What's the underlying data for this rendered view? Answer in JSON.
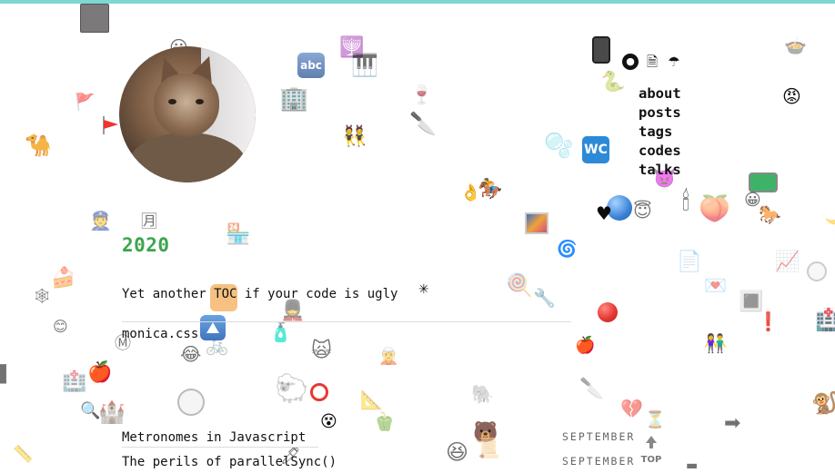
{
  "nav": {
    "icons": [
      {
        "name": "github-icon",
        "glyph": "◉"
      },
      {
        "name": "file-icon",
        "glyph": "🗎"
      },
      {
        "name": "umbrella-icon",
        "glyph": "☂"
      }
    ],
    "links": [
      "about",
      "posts",
      "tags",
      "codes",
      "talks"
    ]
  },
  "content": {
    "year": "2020",
    "post1": "Yet another TOC if your code is ugly",
    "post2": "monica.css",
    "post3": "Metronomes in Javascript",
    "post4": "The perils of parallelSync()",
    "month1": "SEPTEMBER",
    "month2": "SEPTEMBER"
  },
  "labels": {
    "abc": "abc",
    "wc": "WC",
    "top": "TOP"
  },
  "decorations": {
    "emoji": [
      "😀",
      "🐪",
      "🐫",
      "🐍",
      "😡",
      "🐎",
      "🍎",
      "😂",
      "🔧",
      "🏥",
      "🐒",
      "🍏",
      "💔",
      "📜",
      "🔪",
      "⏳",
      "👮",
      "🐘",
      "🌀",
      "🕛",
      "🐫",
      "🌙"
    ]
  },
  "colors": {
    "accent_bar": "#7fd8d0",
    "year_green": "#3aa64c",
    "text": "#111111"
  }
}
